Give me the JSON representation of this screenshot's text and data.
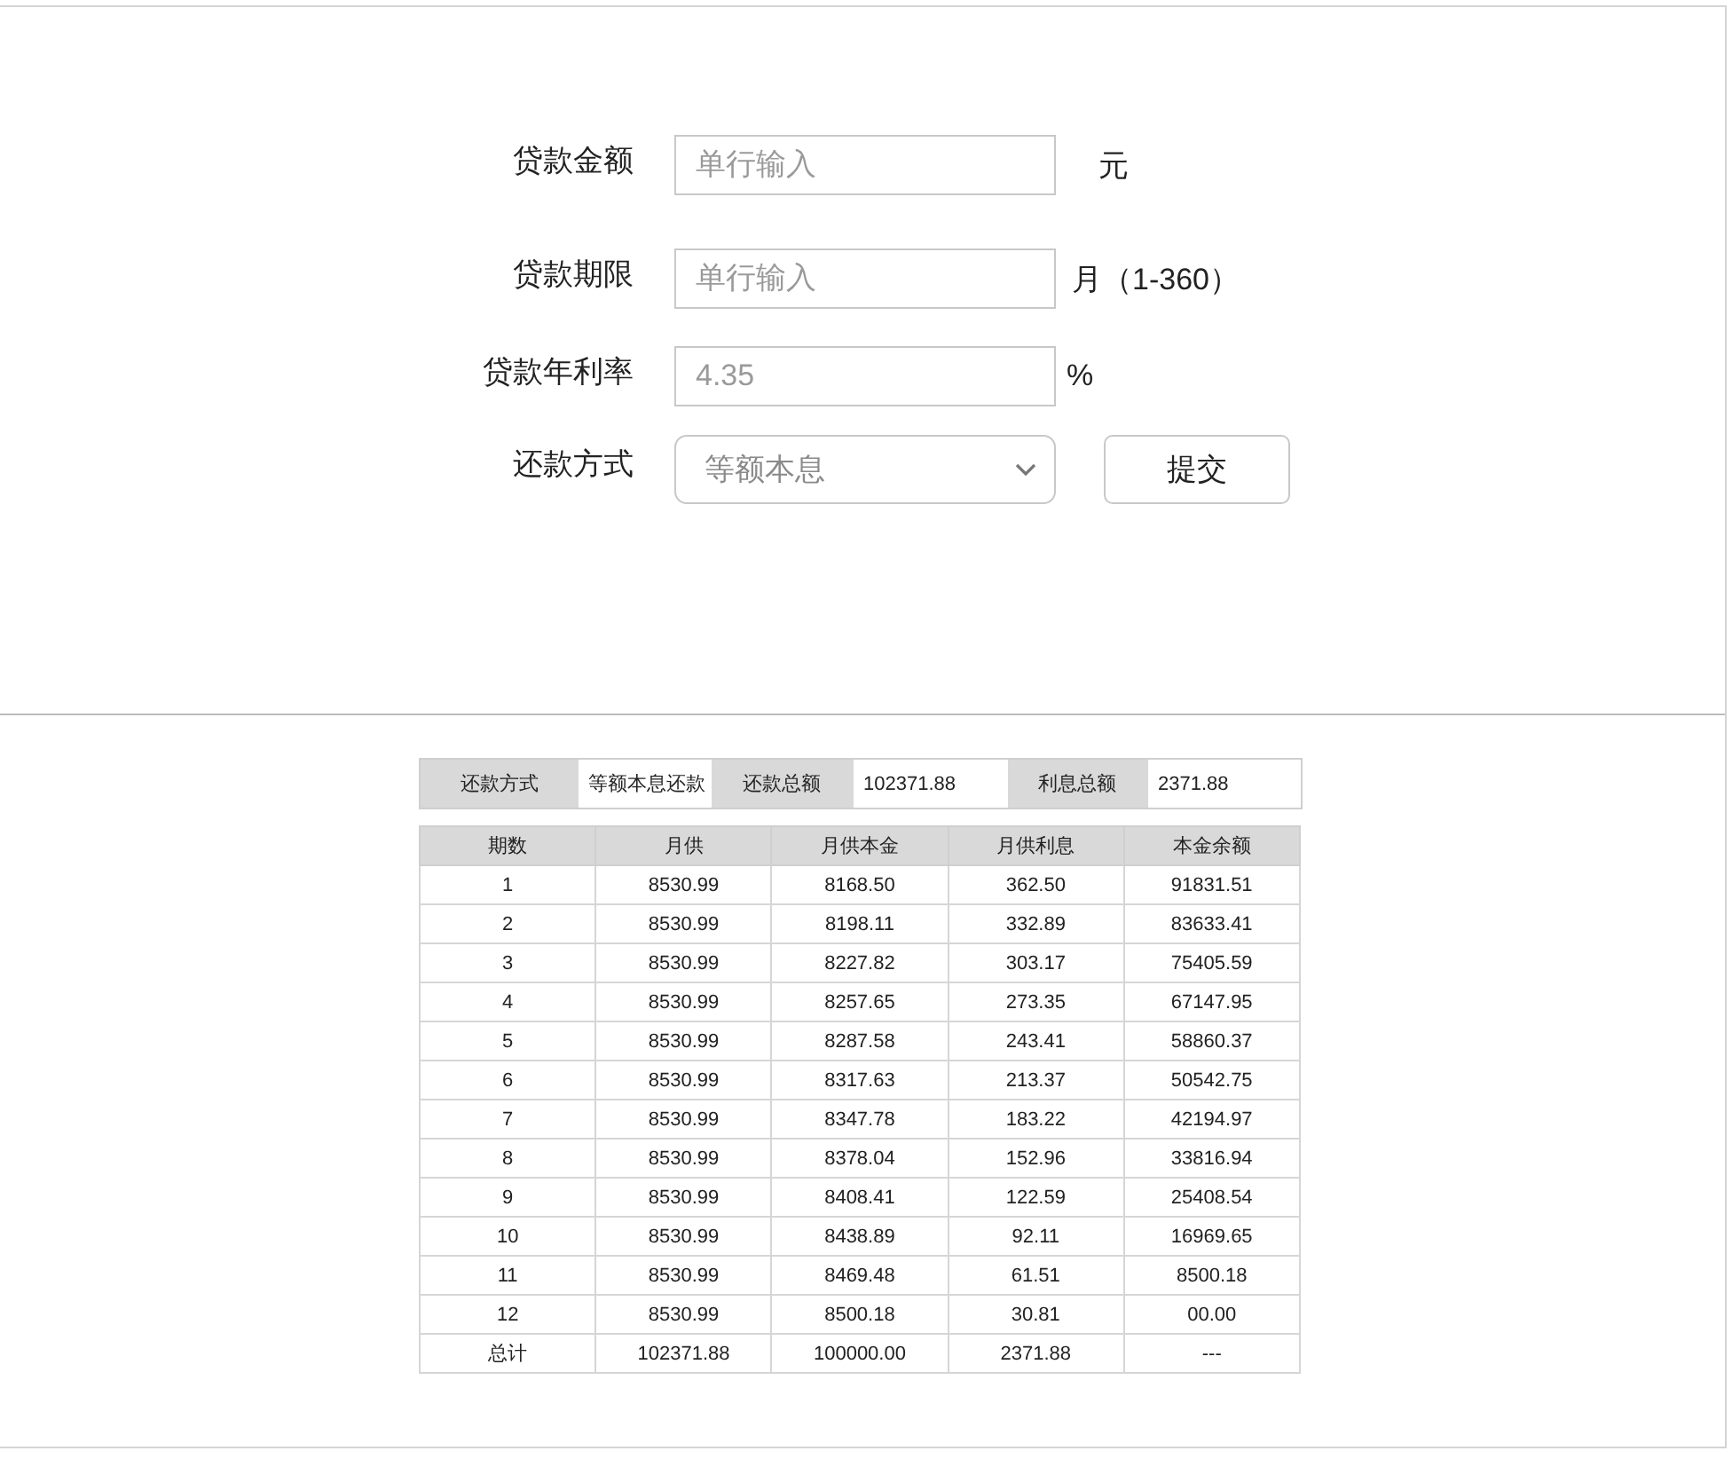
{
  "form": {
    "fields": [
      {
        "kind": "input",
        "label": "贷款金额",
        "placeholder": "单行输入",
        "unit": "元"
      },
      {
        "kind": "input",
        "label": "贷款期限",
        "placeholder": "单行输入",
        "unit": "月（1-360）"
      },
      {
        "kind": "input",
        "label": "贷款年利率",
        "placeholder": "4.35",
        "unit": "%"
      },
      {
        "kind": "select",
        "label": "还款方式",
        "value": "等额本息"
      }
    ],
    "submit": "提交"
  },
  "summary": [
    {
      "label": "还款方式",
      "value": "等额本息还款"
    },
    {
      "label": "还款总额",
      "value": "102371.88"
    },
    {
      "label": "利息总额",
      "value": "2371.88"
    }
  ],
  "schedule": {
    "columns": [
      "期数",
      "月供",
      "月供本金",
      "月供利息",
      "本金余额"
    ],
    "rows": [
      [
        "1",
        "8530.99",
        "8168.50",
        "362.50",
        "91831.51"
      ],
      [
        "2",
        "8530.99",
        "8198.11",
        "332.89",
        "83633.41"
      ],
      [
        "3",
        "8530.99",
        "8227.82",
        "303.17",
        "75405.59"
      ],
      [
        "4",
        "8530.99",
        "8257.65",
        "273.35",
        "67147.95"
      ],
      [
        "5",
        "8530.99",
        "8287.58",
        "243.41",
        "58860.37"
      ],
      [
        "6",
        "8530.99",
        "8317.63",
        "213.37",
        "50542.75"
      ],
      [
        "7",
        "8530.99",
        "8347.78",
        "183.22",
        "42194.97"
      ],
      [
        "8",
        "8530.99",
        "8378.04",
        "152.96",
        "33816.94"
      ],
      [
        "9",
        "8530.99",
        "8408.41",
        "122.59",
        "25408.54"
      ],
      [
        "10",
        "8530.99",
        "8438.89",
        "92.11",
        "16969.65"
      ],
      [
        "11",
        "8530.99",
        "8469.48",
        "61.51",
        "8500.18"
      ],
      [
        "12",
        "8530.99",
        "8500.18",
        "30.81",
        "00.00"
      ],
      [
        "总计",
        "102371.88",
        "100000.00",
        "2371.88",
        "---"
      ]
    ]
  }
}
